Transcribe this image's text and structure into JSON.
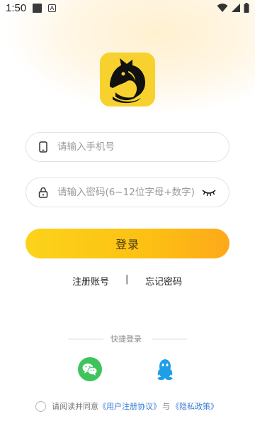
{
  "status_bar": {
    "time": "1:50",
    "a_label": "A"
  },
  "form": {
    "phone_placeholder": "请输入手机号",
    "password_placeholder": "请输入密码(6~12位字母+数字)"
  },
  "buttons": {
    "login_label": "登录"
  },
  "links": {
    "register": "注册账号",
    "separator": "|",
    "forgot": "忘记密码"
  },
  "quick_login": {
    "title": "快捷登录",
    "options": [
      "wechat-icon",
      "qq-icon"
    ]
  },
  "agreement": {
    "prefix": "请阅读并同意",
    "user_agreement": "《用户注册协议》",
    "and": "与",
    "privacy_policy": "《隐私政策》"
  },
  "colors": {
    "accent": "#fdc013",
    "logo_bg": "#f7d22e",
    "wechat": "#3fc35c",
    "qq": "#1f9ee8",
    "link": "#3a7bd5"
  }
}
